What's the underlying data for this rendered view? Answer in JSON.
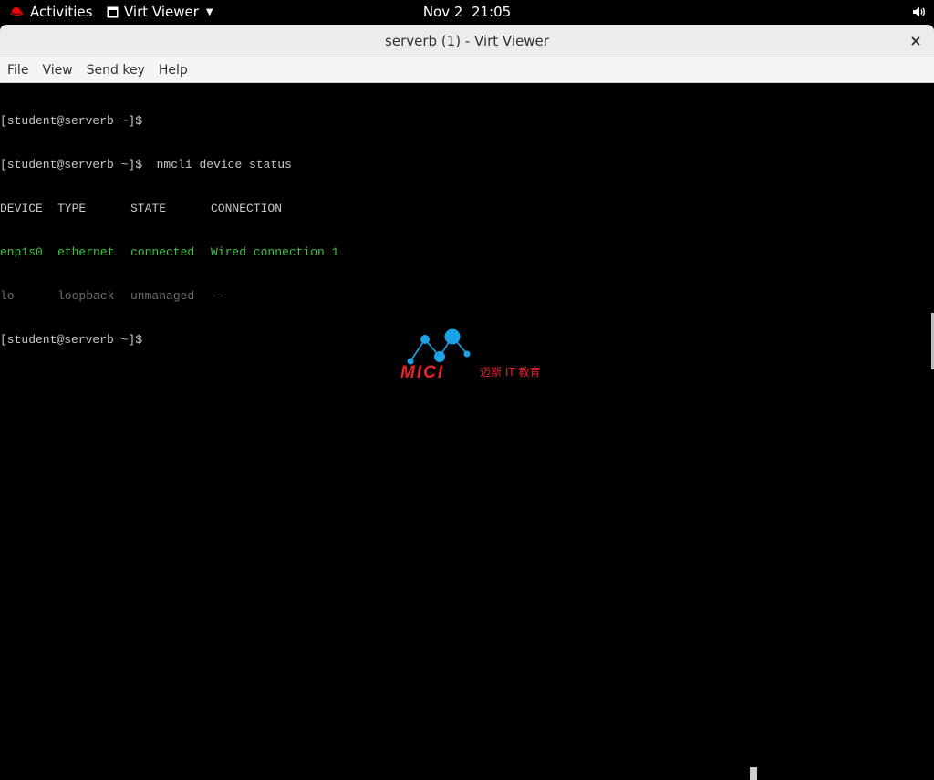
{
  "topbar": {
    "activities_label": "Activities",
    "app_label": "Virt Viewer",
    "date": "Nov 2",
    "time": "21:05",
    "icons": [
      "redhat-icon",
      "window-icon",
      "chevron-down-icon",
      "volume-icon"
    ]
  },
  "window": {
    "title": "serverb (1) - Virt Viewer",
    "close_label": "×"
  },
  "menubar": {
    "items": [
      "File",
      "View",
      "Send key",
      "Help"
    ]
  },
  "terminal": {
    "prompt1": "[student@serverb ~]$",
    "prompt2": "[student@serverb ~]$",
    "command": "  nmcli device status",
    "headers": [
      "DEVICE",
      "TYPE",
      "STATE",
      "CONNECTION"
    ],
    "rows": [
      [
        "enp1s0",
        "ethernet",
        "connected",
        "Wired connection 1"
      ],
      [
        "lo",
        "loopback",
        "unmanaged",
        "--"
      ]
    ],
    "prompt3": "[student@serverb ~]$"
  },
  "watermark": {
    "brand": "MICI",
    "subtitle": "迈斯 IT 教育"
  },
  "colors": {
    "terminal_bg": "#000000",
    "terminal_fg": "#c8c8c8",
    "connected_green": "#3cc33c",
    "unmanaged_gray": "#6c6c6c",
    "logo_red": "#e8222a",
    "logo_blue": "#1aa3e8"
  }
}
